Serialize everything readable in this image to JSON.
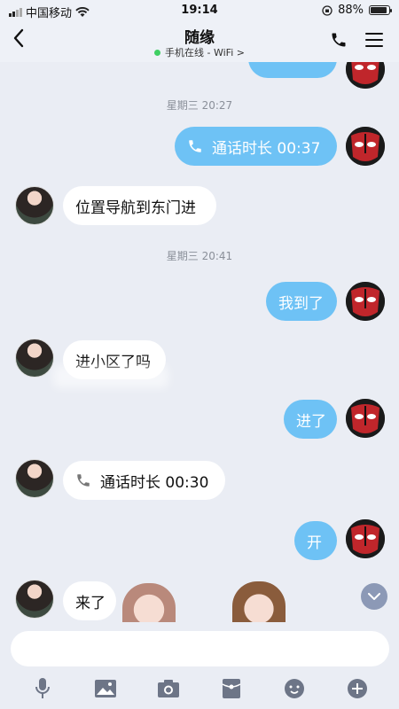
{
  "status_bar": {
    "carrier": "中国移动",
    "time": "19:14",
    "battery_percent": "88%",
    "battery_level": 0.88,
    "icons": [
      "signal-icon",
      "wifi-icon",
      "orientation-lock-icon",
      "battery-icon"
    ]
  },
  "nav": {
    "title": "随缘",
    "status_text": "手机在线 - WiFi",
    "status_chevron": ">",
    "online_color": "#3fcf63",
    "icons": [
      "back-icon",
      "phone-icon",
      "menu-icon"
    ]
  },
  "messages": [
    {
      "type": "time",
      "text": "星期三 20:27"
    },
    {
      "type": "call",
      "from": "me",
      "text": "通话时长 00:37"
    },
    {
      "type": "text",
      "from": "them",
      "text": "位置导航到东门进"
    },
    {
      "type": "time",
      "text": "星期三 20:41"
    },
    {
      "type": "text",
      "from": "me",
      "text": "我到了"
    },
    {
      "type": "text",
      "from": "them",
      "text": "进小区了吗"
    },
    {
      "type": "text",
      "from": "me",
      "text": "进了"
    },
    {
      "type": "call",
      "from": "them",
      "text": "通话时长 00:30"
    },
    {
      "type": "text",
      "from": "me",
      "text": "开"
    },
    {
      "type": "text",
      "from": "them",
      "text": "来了"
    }
  ],
  "colors": {
    "my_bubble": "#6ec2f5",
    "their_bubble": "#ffffff",
    "background": "#eaedf4"
  },
  "input": {
    "value": "",
    "placeholder": ""
  },
  "toolbar": {
    "icons": [
      "microphone-icon",
      "image-icon",
      "camera-icon",
      "red-packet-icon",
      "emoji-icon",
      "plus-icon"
    ]
  }
}
